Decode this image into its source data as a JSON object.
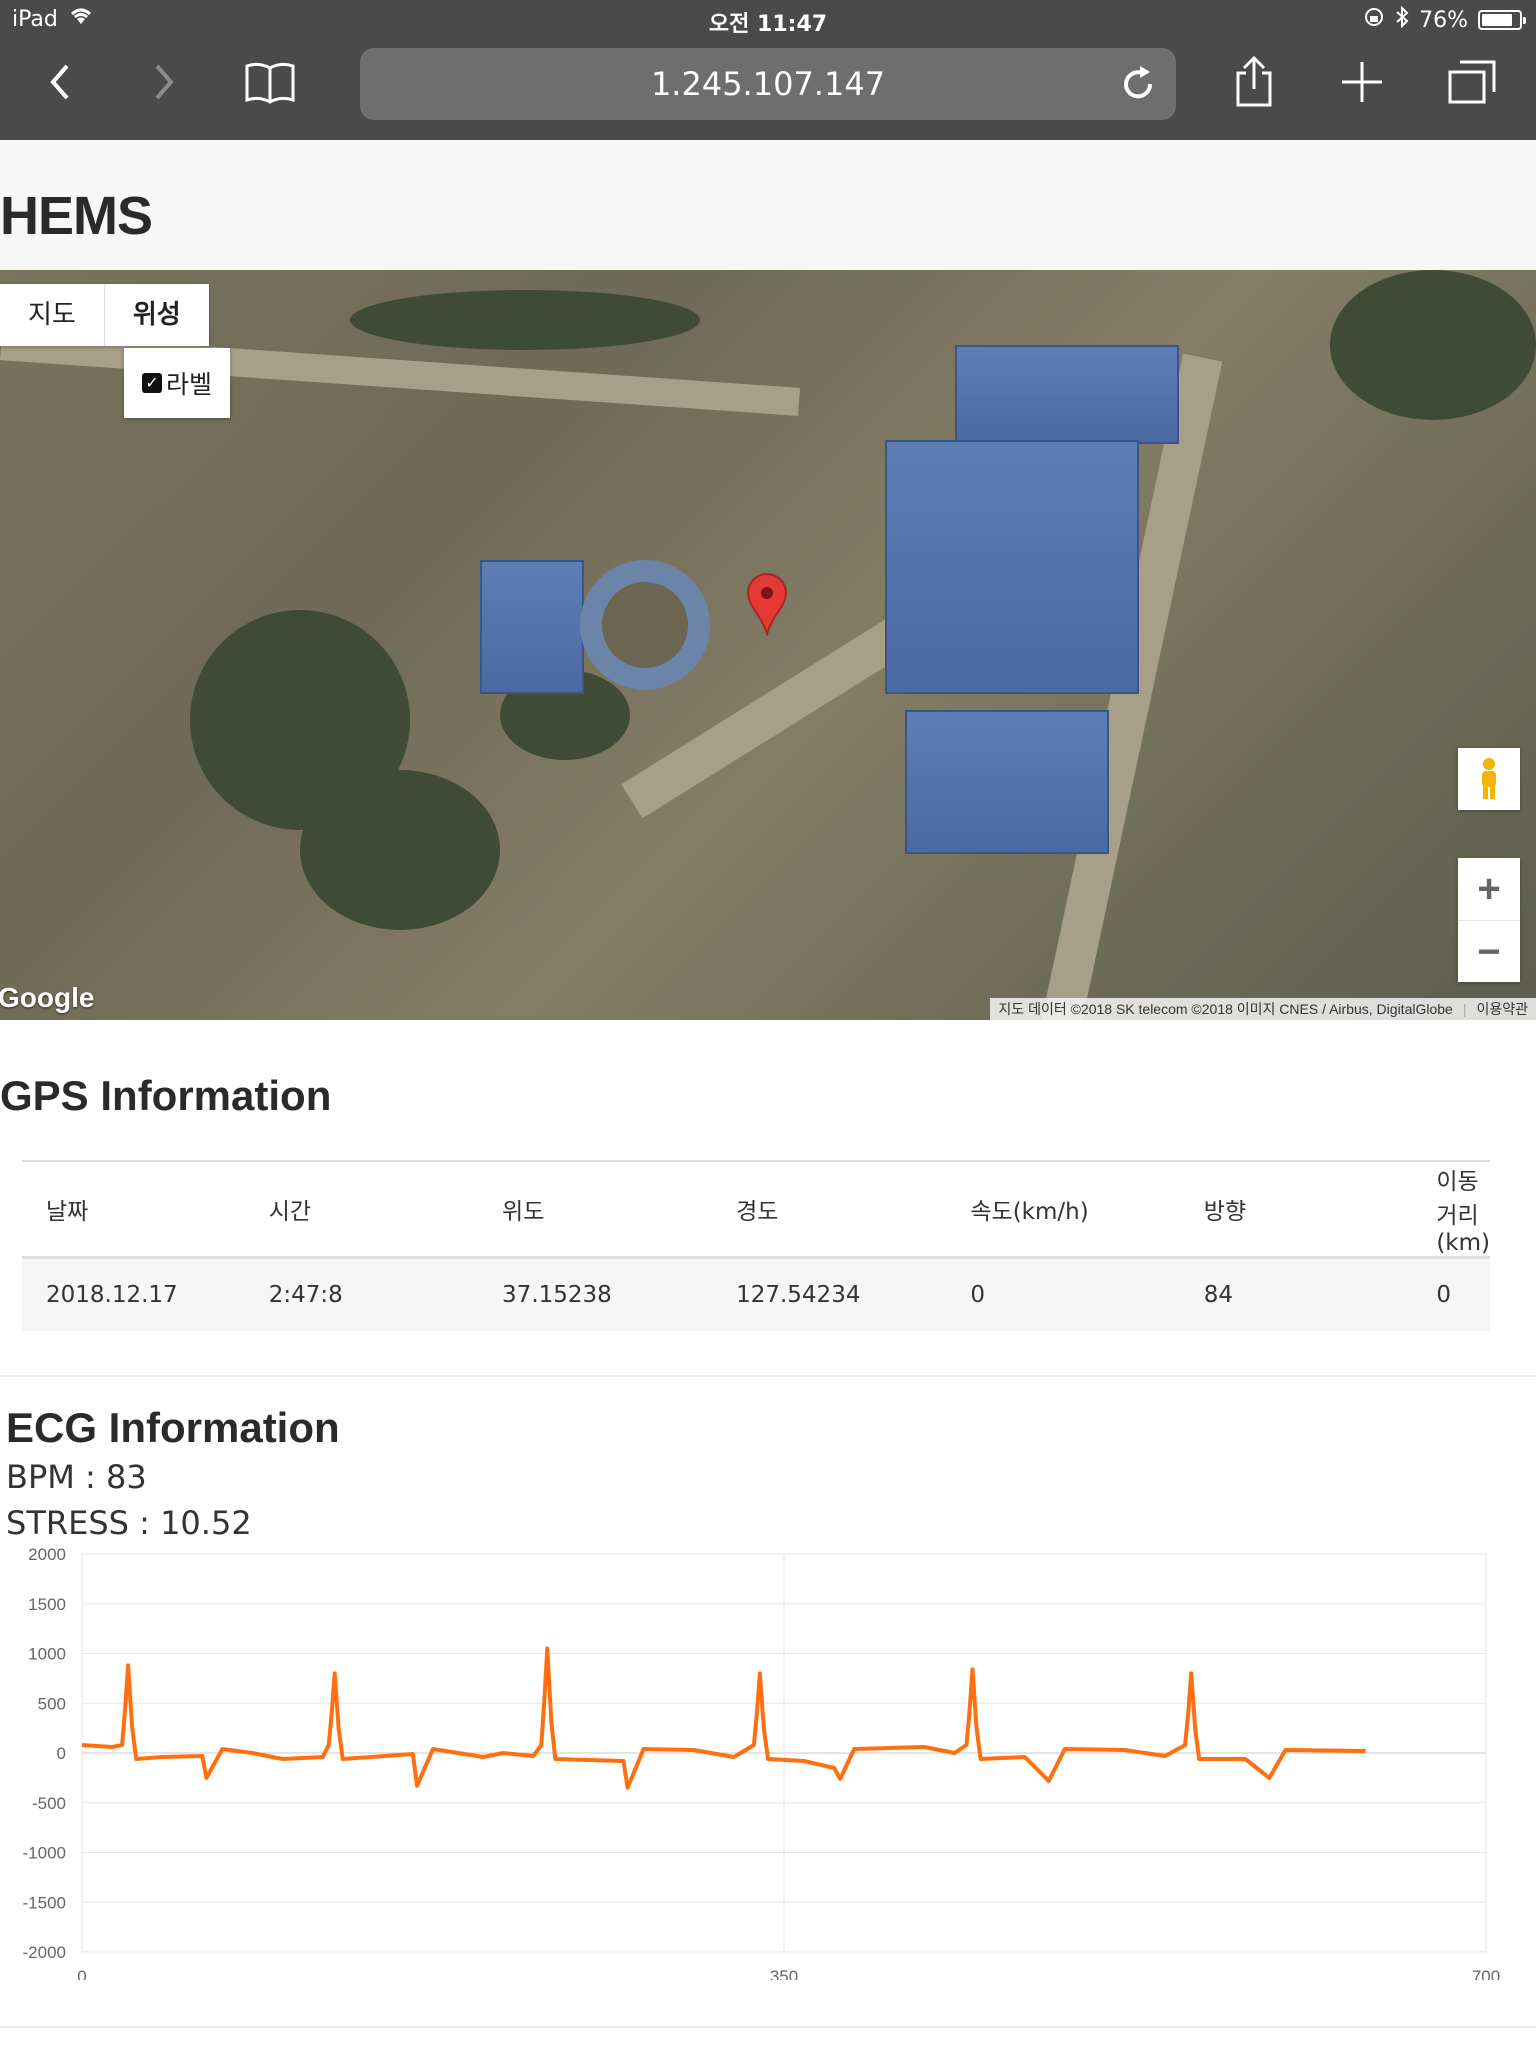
{
  "status_bar": {
    "device": "iPad",
    "time": "오전 11:47",
    "battery": "76%",
    "battery_level": 0.76
  },
  "browser": {
    "url": "1.245.107.147"
  },
  "page": {
    "title": "HEMS"
  },
  "map": {
    "type_options": [
      "지도",
      "위성"
    ],
    "selected_type": "위성",
    "label_checkbox": "라벨",
    "google_logo": "Google",
    "attribution": "지도 데이터 ©2018 SK telecom ©2018 이미지 CNES / Airbus, DigitalGlobe",
    "terms": "이용약관"
  },
  "gps": {
    "title": "GPS Information",
    "columns": [
      "날짜",
      "시간",
      "위도",
      "경도",
      "속도(km/h)",
      "방향",
      "이동거리(km)"
    ],
    "rows": [
      [
        "2018.12.17",
        "2:47:8",
        "37.15238",
        "127.54234",
        "0",
        "84",
        "0"
      ]
    ]
  },
  "ecg": {
    "title": "ECG Information",
    "bpm": "BPM : 83",
    "stress": "STRESS : 10.52"
  },
  "chart_data": {
    "type": "line",
    "title": "",
    "xlabel": "",
    "ylabel": "",
    "xlim": [
      0,
      700
    ],
    "ylim": [
      -2000,
      2000
    ],
    "x_ticks": [
      "0",
      "350",
      "700"
    ],
    "y_ticks": [
      "2000",
      "1500",
      "1000",
      "500",
      "0",
      "-500",
      "-1000",
      "-1500",
      "-2000"
    ],
    "grid": true,
    "line_color": "#ff6f0f",
    "x_end": 640,
    "series": [
      {
        "peaks": [
          {
            "x": 23,
            "r": 880,
            "s": -250,
            "t": 80
          },
          {
            "x": 126,
            "r": 800,
            "s": -250,
            "t": 80
          },
          {
            "x": 232,
            "r": 1050,
            "s": -320,
            "t": 80
          },
          {
            "x": 338,
            "r": 800,
            "s": -220,
            "t": 80
          },
          {
            "x": 444,
            "r": 840,
            "s": -250,
            "t": 80
          },
          {
            "x": 553,
            "r": 800,
            "s": -220,
            "t": 80
          }
        ],
        "baseline": [
          [
            0,
            80
          ],
          [
            15,
            60
          ],
          [
            40,
            -40
          ],
          [
            60,
            -30
          ],
          [
            62,
            -250
          ],
          [
            70,
            40
          ],
          [
            85,
            0
          ],
          [
            100,
            -60
          ],
          [
            120,
            -40
          ],
          [
            165,
            -10
          ],
          [
            167,
            -330
          ],
          [
            175,
            40
          ],
          [
            200,
            -40
          ],
          [
            210,
            0
          ],
          [
            225,
            -30
          ],
          [
            270,
            -80
          ],
          [
            272,
            -350
          ],
          [
            280,
            40
          ],
          [
            305,
            30
          ],
          [
            325,
            -40
          ],
          [
            360,
            -80
          ],
          [
            375,
            -150
          ],
          [
            378,
            -260
          ],
          [
            385,
            40
          ],
          [
            420,
            60
          ],
          [
            435,
            0
          ],
          [
            470,
            -40
          ],
          [
            482,
            -280
          ],
          [
            490,
            40
          ],
          [
            520,
            30
          ],
          [
            540,
            -30
          ],
          [
            580,
            -60
          ],
          [
            592,
            -250
          ],
          [
            600,
            30
          ],
          [
            640,
            20
          ]
        ]
      }
    ]
  }
}
